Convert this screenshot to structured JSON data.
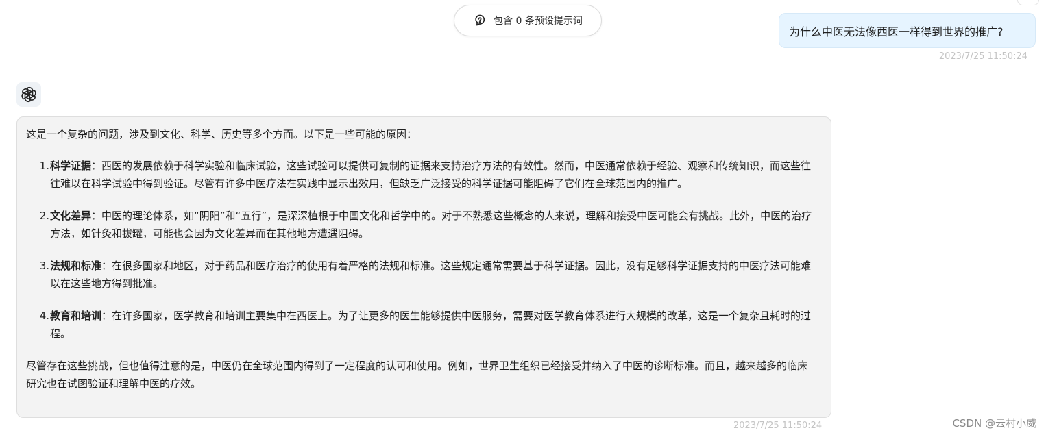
{
  "prompt_pill": {
    "label": "包含 0 条预设提示词",
    "icon": "prompt-bulb-icon"
  },
  "user_message": {
    "text": "为什么中医无法像西医一样得到世界的推广?",
    "timestamp": "2023/7/25 11:50:24"
  },
  "assistant_message": {
    "avatar_icon": "openai-logo-icon",
    "intro": "这是一个复杂的问题，涉及到文化、科学、历史等多个方面。以下是一些可能的原因：",
    "items": [
      {
        "number": "1.",
        "title": "科学证据",
        "text": "：西医的发展依赖于科学实验和临床试验，这些试验可以提供可复制的证据来支持治疗方法的有效性。然而，中医通常依赖于经验、观察和传统知识，而这些往往难以在科学试验中得到验证。尽管有许多中医疗法在实践中显示出效用，但缺乏广泛接受的科学证据可能阻碍了它们在全球范围内的推广。"
      },
      {
        "number": "2.",
        "title": "文化差异",
        "text": "：中医的理论体系，如“阴阳”和“五行”，是深深植根于中国文化和哲学中的。对于不熟悉这些概念的人来说，理解和接受中医可能会有挑战。此外，中医的治疗方法，如针灸和拔罐，可能也会因为文化差异而在其他地方遭遇阻碍。"
      },
      {
        "number": "3.",
        "title": "法规和标准",
        "text": "：在很多国家和地区，对于药品和医疗治疗的使用有着严格的法规和标准。这些规定通常需要基于科学证据。因此，没有足够科学证据支持的中医疗法可能难以在这些地方得到批准。"
      },
      {
        "number": "4.",
        "title": "教育和培训",
        "text": "：在许多国家，医学教育和培训主要集中在西医上。为了让更多的医生能够提供中医服务，需要对医学教育体系进行大规模的改革，这是一个复杂且耗时的过程。"
      }
    ],
    "conclusion": "尽管存在这些挑战，但也值得注意的是，中医仍在全球范围内得到了一定程度的认可和使用。例如，世界卫生组织已经接受并纳入了中医的诊断标准。而且，越来越多的临床研究也在试图验证和理解中医的疗效。",
    "timestamp": "2023/7/25 11:50:24"
  },
  "watermark": "CSDN @云村小威"
}
